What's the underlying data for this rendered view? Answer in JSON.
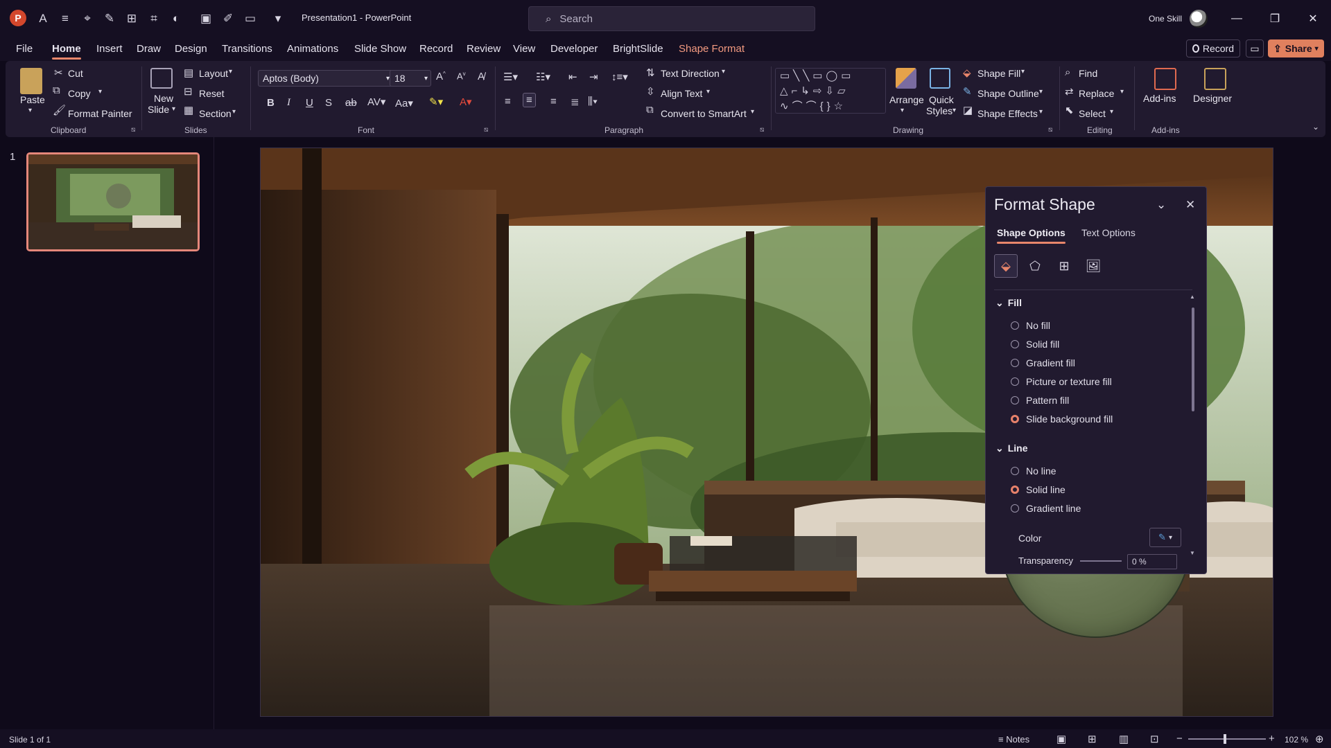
{
  "titlebar": {
    "doc_title": "Presentation1  -  PowerPoint",
    "search_placeholder": "Search",
    "user_name": "One Skill"
  },
  "tabs": [
    "File",
    "Home",
    "Insert",
    "Draw",
    "Design",
    "Transitions",
    "Animations",
    "Slide Show",
    "Record",
    "Review",
    "View",
    "Developer",
    "BrightSlide",
    "Shape Format"
  ],
  "active_tab": "Home",
  "header_buttons": {
    "record": "Record",
    "share": "Share"
  },
  "ribbon": {
    "clipboard": {
      "paste": "Paste",
      "cut": "Cut",
      "copy": "Copy",
      "format_painter": "Format Painter",
      "group": "Clipboard"
    },
    "slides": {
      "new_slide_1": "New",
      "new_slide_2": "Slide",
      "layout": "Layout",
      "reset": "Reset",
      "section": "Section",
      "group": "Slides"
    },
    "font": {
      "font_name": "Aptos (Body)",
      "font_size": "18",
      "group": "Font"
    },
    "paragraph": {
      "text_direction": "Text Direction",
      "align_text": "Align Text",
      "convert_smartart": "Convert to SmartArt",
      "group": "Paragraph"
    },
    "drawing": {
      "arrange": "Arrange",
      "quick_styles_1": "Quick",
      "quick_styles_2": "Styles",
      "shape_fill": "Shape Fill",
      "shape_outline": "Shape Outline",
      "shape_effects": "Shape Effects",
      "group": "Drawing"
    },
    "editing": {
      "find": "Find",
      "replace": "Replace",
      "select": "Select",
      "group": "Editing"
    },
    "addins": {
      "addins": "Add-ins",
      "designer": "Designer",
      "group": "Add-ins"
    }
  },
  "slides_pane": {
    "slide_number": "1"
  },
  "format_shape": {
    "title": "Format Shape",
    "tabs": [
      "Shape Options",
      "Text Options"
    ],
    "fill": {
      "heading": "Fill",
      "options": [
        "No fill",
        "Solid fill",
        "Gradient fill",
        "Picture or texture fill",
        "Pattern fill",
        "Slide background fill"
      ],
      "selected": "Slide background fill"
    },
    "line": {
      "heading": "Line",
      "options": [
        "No line",
        "Solid line",
        "Gradient line"
      ],
      "selected": "Solid line",
      "color_label": "Color",
      "transparency_label": "Transparency",
      "transparency_value": "0 %"
    }
  },
  "status": {
    "slide_info": "Slide 1 of 1",
    "notes": "Notes",
    "zoom": "102 %"
  },
  "colors": {
    "accent": "#e8866b",
    "share_bg": "#e0805e",
    "shape_format_tab": "#f39a80",
    "app_bg": "#150f22"
  }
}
